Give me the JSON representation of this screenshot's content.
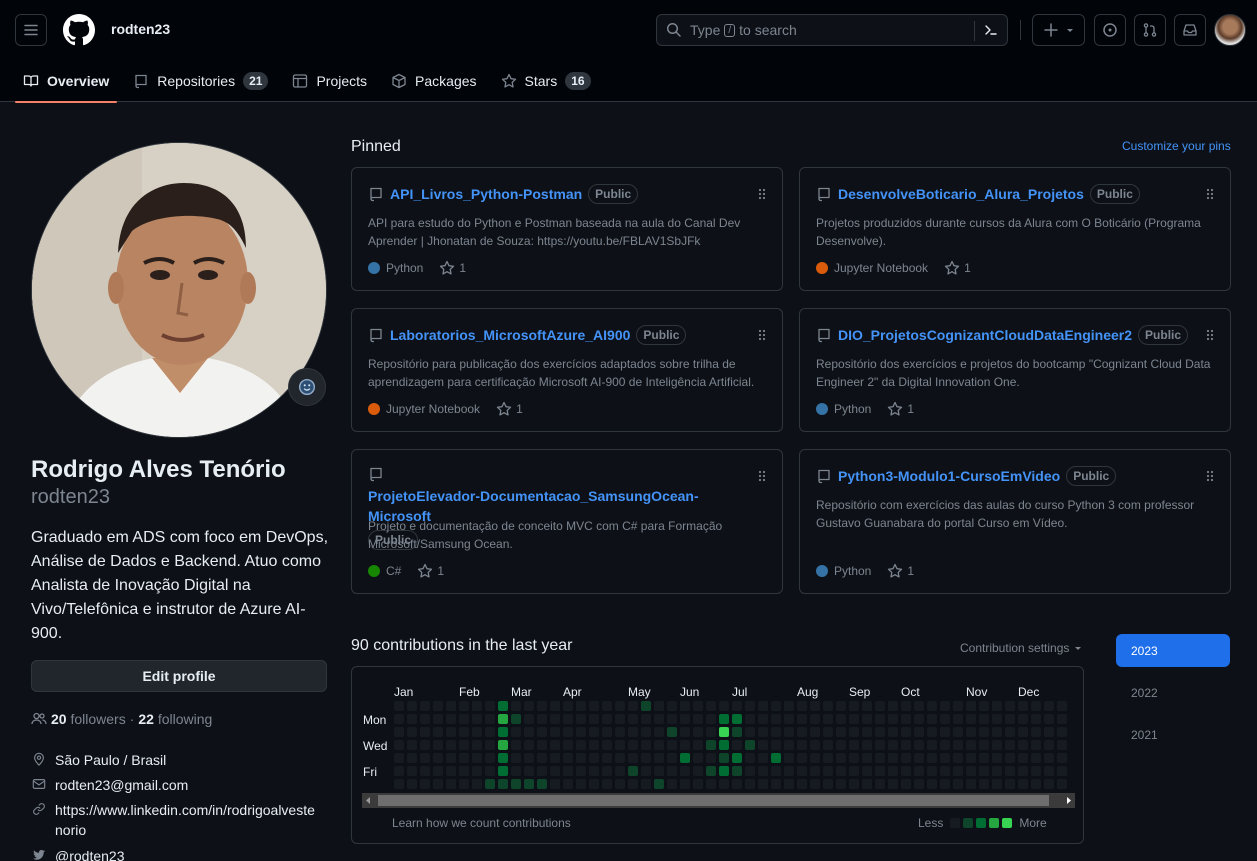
{
  "header": {
    "username": "rodten23",
    "search_before": "Type",
    "search_key": "/",
    "search_after": "to search"
  },
  "tabs": [
    {
      "label": "Overview",
      "count": null
    },
    {
      "label": "Repositories",
      "count": "21"
    },
    {
      "label": "Projects",
      "count": null
    },
    {
      "label": "Packages",
      "count": null
    },
    {
      "label": "Stars",
      "count": "16"
    }
  ],
  "profile": {
    "full_name": "Rodrigo Alves Tenório",
    "login": "rodten23",
    "bio": "Graduado em ADS com foco em DevOps, Análise de Dados e Backend. Atuo como Analista de Inovação Digital na Vivo/Telefônica e instrutor de Azure AI-900.",
    "edit_label": "Edit profile",
    "followers": "20",
    "followers_label": "followers",
    "following": "22",
    "following_label": "following",
    "location": "São Paulo / Brasil",
    "email": "rodten23@gmail.com",
    "website_line1": "https://www.linkedin.com/in/rodrigoalveste",
    "website_line2": "norio",
    "twitter": "@rodten23"
  },
  "pinned": {
    "title": "Pinned",
    "customize": "Customize your pins",
    "cards": [
      {
        "name": "API_Livros_Python-Postman",
        "visibility": "Public",
        "desc": "API para estudo do Python e Postman baseada na aula do Canal Dev Aprender | Jhonatan de Souza: https://youtu.be/FBLAV1SbJFk",
        "lang": "Python",
        "lang_color": "#3572A5",
        "stars": "1"
      },
      {
        "name": "DesenvolveBoticario_Alura_Projetos",
        "visibility": "Public",
        "desc": "Projetos produzidos durante cursos da Alura com O Boticário (Programa Desenvolve).",
        "lang": "Jupyter Notebook",
        "lang_color": "#DA5B0B",
        "stars": "1"
      },
      {
        "name": "Laboratorios_MicrosoftAzure_AI900",
        "visibility": "Public",
        "desc": "Repositório para publicação dos exercícios adaptados sobre trilha de aprendizagem para certificação Microsoft AI-900 de Inteligência Artificial.",
        "lang": "Jupyter Notebook",
        "lang_color": "#DA5B0B",
        "stars": "1"
      },
      {
        "name": "DIO_ProjetosCognizantCloudDataEngineer2",
        "visibility": "Public",
        "desc": "Repositório dos exercícios e projetos do bootcamp \"Cognizant Cloud Data Engineer 2\" da Digital Innovation One.",
        "lang": "Python",
        "lang_color": "#3572A5",
        "stars": "1"
      },
      {
        "name": "ProjetoElevador-Documentacao_SamsungOcean-Microsoft",
        "visibility": "Public",
        "desc": "Projeto e documentação de conceito MVC com C# para Formação Microsoft/Samsung Ocean.",
        "lang": "C#",
        "lang_color": "#178600",
        "stars": "1"
      },
      {
        "name": "Python3-Modulo1-CursoEmVideo",
        "visibility": "Public",
        "desc": "Repositório com exercícios das aulas do curso Python 3 com professor Gustavo Guanabara do portal Curso em Vídeo.",
        "lang": "Python",
        "lang_color": "#3572A5",
        "stars": "1"
      }
    ]
  },
  "contributions": {
    "title": "90 contributions in the last year",
    "settings": "Contribution settings",
    "months": [
      "Jan",
      "Feb",
      "Mar",
      "Apr",
      "May",
      "Jun",
      "Jul",
      "Aug",
      "Sep",
      "Oct",
      "Nov",
      "Dec"
    ],
    "days": [
      "Mon",
      "Wed",
      "Fri"
    ],
    "learn": "Learn how we count contributions",
    "less": "Less",
    "more": "More",
    "levels": [
      "#161b22",
      "#0e4429",
      "#006d32",
      "#26a641",
      "#39d353"
    ],
    "active_cells": [
      [
        8,
        0,
        2
      ],
      [
        8,
        1,
        3
      ],
      [
        8,
        2,
        2
      ],
      [
        8,
        3,
        3
      ],
      [
        8,
        4,
        2
      ],
      [
        8,
        5,
        2
      ],
      [
        8,
        6,
        1
      ],
      [
        9,
        1,
        1
      ],
      [
        9,
        6,
        1
      ],
      [
        10,
        6,
        1
      ],
      [
        11,
        6,
        1
      ],
      [
        7,
        6,
        1
      ],
      [
        18,
        5,
        1
      ],
      [
        19,
        0,
        1
      ],
      [
        20,
        6,
        1
      ],
      [
        21,
        2,
        1
      ],
      [
        22,
        4,
        2
      ],
      [
        24,
        3,
        1
      ],
      [
        24,
        5,
        1
      ],
      [
        25,
        1,
        2
      ],
      [
        25,
        2,
        4
      ],
      [
        25,
        3,
        2
      ],
      [
        25,
        4,
        1
      ],
      [
        25,
        5,
        2
      ],
      [
        26,
        1,
        2
      ],
      [
        26,
        2,
        1
      ],
      [
        26,
        4,
        2
      ],
      [
        26,
        5,
        1
      ],
      [
        27,
        3,
        1
      ],
      [
        29,
        4,
        2
      ]
    ]
  },
  "years": [
    "2023",
    "2022",
    "2021"
  ]
}
